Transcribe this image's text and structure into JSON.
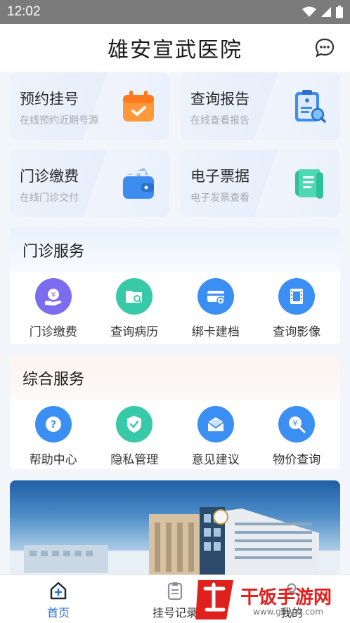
{
  "status": {
    "time": "12:02"
  },
  "header": {
    "title": "雄安宣武医院"
  },
  "cards": [
    {
      "title": "预约挂号",
      "subtitle": "在线预约近期号源",
      "icon": "calendar-icon"
    },
    {
      "title": "查询报告",
      "subtitle": "在线查看报告",
      "icon": "report-clipboard-icon"
    },
    {
      "title": "门诊缴费",
      "subtitle": "在线门诊交付",
      "icon": "wallet-icon"
    },
    {
      "title": "电子票据",
      "subtitle": "电子发票查看",
      "icon": "scroll-receipt-icon"
    }
  ],
  "outpatient": {
    "title": "门诊服务",
    "items": [
      {
        "label": "门诊缴费",
        "icon": "yuan-hand-icon",
        "color": "#7b6cf0"
      },
      {
        "label": "查询病历",
        "icon": "folder-search-icon",
        "color": "#38c9a8"
      },
      {
        "label": "绑卡建档",
        "icon": "card-add-icon",
        "color": "#3b8ff3"
      },
      {
        "label": "查询影像",
        "icon": "film-icon",
        "color": "#3b8ff3"
      }
    ]
  },
  "general": {
    "title": "综合服务",
    "items": [
      {
        "label": "帮助中心",
        "icon": "help-question-icon",
        "color": "#3b8ff3"
      },
      {
        "label": "隐私管理",
        "icon": "shield-check-icon",
        "color": "#38c9a8"
      },
      {
        "label": "意见建议",
        "icon": "mail-feedback-icon",
        "color": "#3b8ff3"
      },
      {
        "label": "物价查询",
        "icon": "price-search-icon",
        "color": "#3b8ff3"
      }
    ]
  },
  "nav": [
    {
      "label": "首页",
      "icon": "home-icon",
      "active": true
    },
    {
      "label": "挂号记录",
      "icon": "clipboard-list-icon",
      "active": false
    },
    {
      "label": "我的",
      "icon": "user-icon",
      "active": false
    }
  ],
  "watermark": {
    "text": "干饭手游网",
    "url": "www.gfhyxt.com"
  }
}
